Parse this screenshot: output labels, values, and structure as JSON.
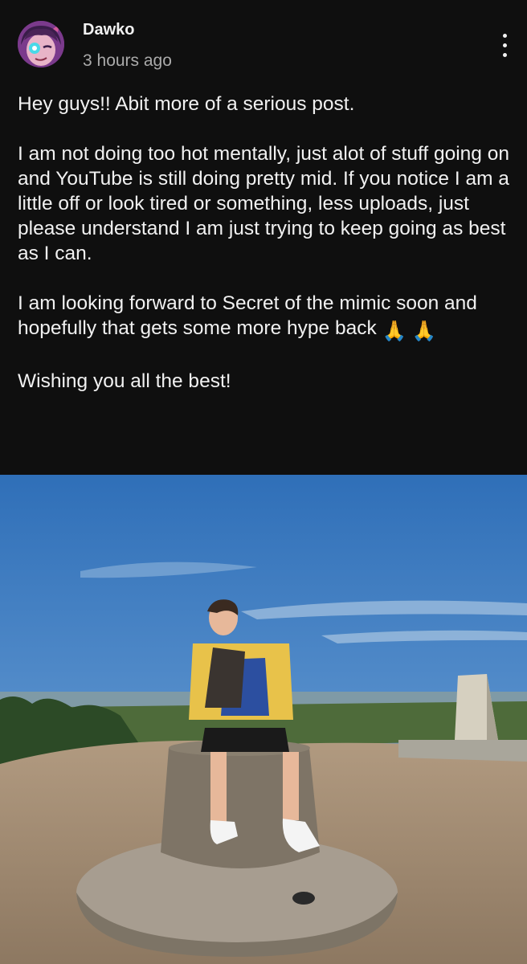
{
  "post": {
    "author": "Dawko",
    "timestamp": "3 hours ago",
    "menu_icon": "more-vertical-icon",
    "paragraphs": [
      "Hey guys!! Abit more of a serious post.",
      "I am not doing too hot mentally, just alot of stuff going on and YouTube is still doing pretty mid. If you notice I am a little off or look tired or something, less uploads, just please understand I am just trying to keep going as best as I can.",
      "I am looking forward to Secret of the mimic soon and hopefully that gets some more hype back",
      "Wishing you all the best!"
    ],
    "emoji": "🙏 🙏"
  },
  "colors": {
    "background": "#0f0f0f",
    "text": "#f1f1f1",
    "secondary_text": "#aaaaaa",
    "sky": "#3f7fc4"
  }
}
